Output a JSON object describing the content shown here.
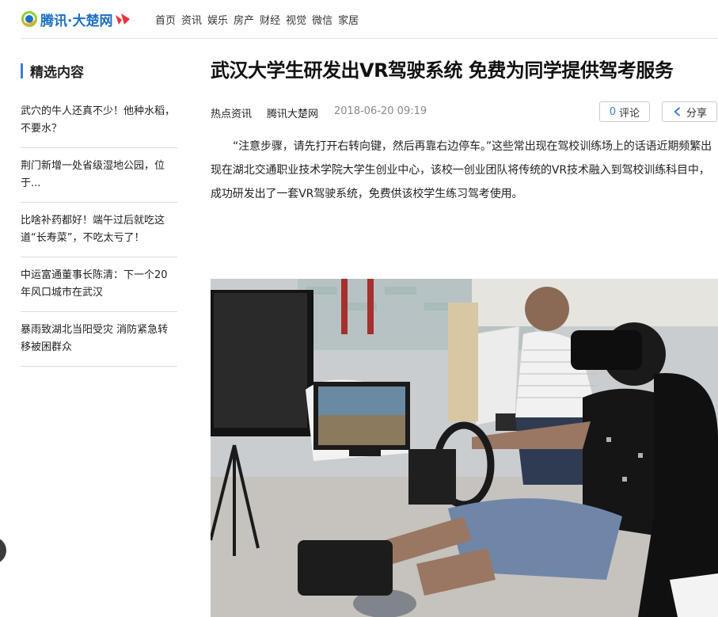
{
  "site": {
    "logo_text": "腾讯·大楚网"
  },
  "nav": [
    "首页",
    "资讯",
    "娱乐",
    "房产",
    "财经",
    "视觉",
    "微信",
    "家居"
  ],
  "sidebar": {
    "title": "精选内容",
    "items": [
      "武穴的牛人还真不少！他种水稻，不要水？",
      "荆门新增一处省级湿地公园，位于...",
      "比啥补药都好！端午过后就吃这道“长寿菜”，不吃太亏了！",
      "中运富通董事长陈清：下一个20年风口城市在武汉",
      "暴雨致湖北当阳受灾 消防紧急转移被困群众"
    ]
  },
  "article": {
    "title": "武汉大学生研发出VR驾驶系统 免费为同学提供驾考服务",
    "category": "热点资讯",
    "source": "腾讯大楚网",
    "time": "2018-06-20 09:19",
    "comment_count": "0",
    "comment_label": "评论",
    "share_label": "分享",
    "paragraph": "“注意步骤，请先打开右转向键，然后再靠右边停车。”这些常出现在驾校训练场上的话语近期频繁出现在湖北交通职业技术学院大学生创业中心，该校一创业团队将传统的VR技术融入到驾校训练科目中，成功研发出了一套VR驾驶系统，免费供该校学生练习驾考使用。"
  },
  "colors": {
    "accent": "#3a7fd5",
    "logo_blue": "#1c6fc1",
    "logo_red": "#e8313c"
  },
  "icons": {
    "share": "share-icon",
    "logo": "logo-icon"
  }
}
